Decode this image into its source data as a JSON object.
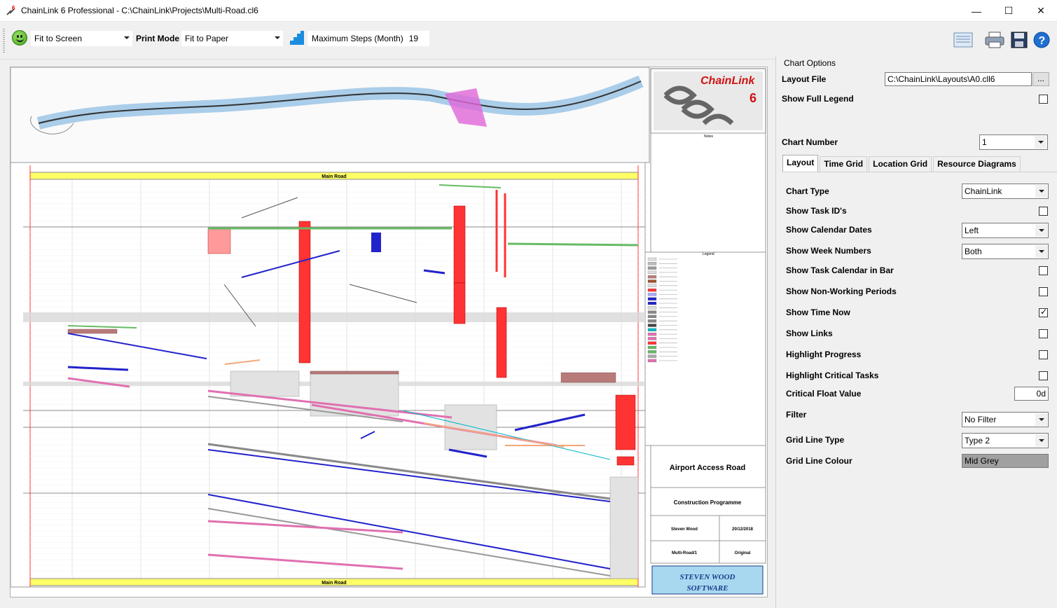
{
  "window": {
    "title": "ChainLink 6 Professional - C:\\ChainLink\\Projects\\Multi-Road.cl6",
    "buttons": {
      "minimize": "—",
      "maximize": "☐",
      "close": "✕"
    }
  },
  "toolbar": {
    "zoom_value": "Fit to Screen",
    "print_mode_label": "Print Mode",
    "print_mode_value": "Fit to Paper",
    "max_steps_label": "Maximum Steps (Month)",
    "max_steps_value": "19"
  },
  "chart": {
    "top_road_title": "Main Road",
    "bottom_road_title": "Main Road",
    "legend_title": "Legend",
    "notes_title": "Notes",
    "logo_text": "ChainLink",
    "logo_number": "6",
    "project_title": "Airport Access Road",
    "chart_title": "Construction Programme",
    "produced_by": "Steven Wood",
    "print_date": "20/12/2018",
    "chart_number": "Multi-Road/1",
    "revision": "Original",
    "company_logo_line1": "STEVEN WOOD",
    "company_logo_line2": "SOFTWARE",
    "colors": {
      "grid": "#c8c8c8",
      "road_band": "#ffff66",
      "task_red": "#ff3333",
      "task_blue": "#2222cc",
      "task_pink": "#e070b0",
      "shade": "#d8d8d8"
    }
  },
  "panel": {
    "title": "Chart Options",
    "layout_file_label": "Layout File",
    "layout_file_value": "C:\\ChainLink\\Layouts\\A0.cll6",
    "browse_label": "...",
    "show_full_legend_label": "Show Full Legend",
    "chart_number_label": "Chart Number",
    "chart_number_value": "1",
    "tabs": [
      {
        "label": "Layout"
      },
      {
        "label": "Time Grid"
      },
      {
        "label": "Location Grid"
      },
      {
        "label": "Resource Diagrams"
      }
    ],
    "options": {
      "chart_type_label": "Chart Type",
      "chart_type_value": "ChainLink",
      "show_task_ids_label": "Show Task ID's",
      "show_calendar_dates_label": "Show Calendar Dates",
      "show_calendar_dates_value": "Left",
      "show_week_numbers_label": "Show Week Numbers",
      "show_week_numbers_value": "Both",
      "show_task_calendar_label": "Show Task Calendar in Bar",
      "show_non_working_label": "Show Non-Working Periods",
      "show_time_now_label": "Show Time Now",
      "show_links_label": "Show Links",
      "highlight_progress_label": "Highlight Progress",
      "highlight_critical_label": "Highlight Critical Tasks",
      "critical_float_label": "Critical Float Value",
      "critical_float_value": "0d",
      "filter_label": "Filter",
      "filter_value": "No Filter",
      "grid_line_type_label": "Grid Line Type",
      "grid_line_type_value": "Type 2",
      "grid_line_colour_label": "Grid Line Colour",
      "grid_line_colour_value": "Mid Grey"
    }
  }
}
